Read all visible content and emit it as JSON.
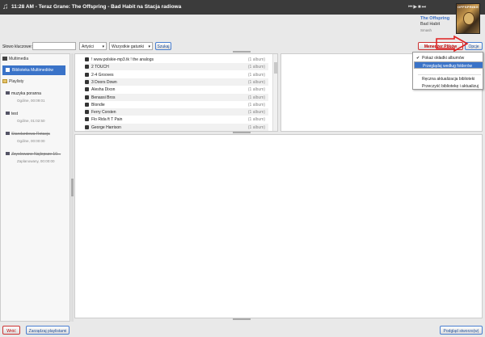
{
  "topbar": {
    "now_playing": "11:28 AM - Teraz Grane: The Offspring - Bad Habit na Stacja radiowa"
  },
  "track": {
    "artist": "The Offspring",
    "song": "Bad Habit",
    "album": "Smash",
    "cover_label": "OFFSPRING"
  },
  "search": {
    "label": "Słowo kluczowe:",
    "value": "",
    "type_select": "Artyści",
    "genre_select": "Wszystkie gatunki",
    "search_button": "Szukaj",
    "manager_button": "Menedżer Plików",
    "options_button": "Opcje"
  },
  "sidebar": {
    "multimedia": "Multimedia",
    "library": "Biblioteka Multimediów",
    "playlists_header": "Playlisty",
    "playlists": [
      {
        "name": "muzyka poranna",
        "meta": "Ogólne, 00:09:01",
        "strike": false
      },
      {
        "name": "test",
        "meta": "Ogólne, 01:02:50",
        "strike": false
      },
      {
        "name": "Standardowa Rotacja",
        "meta": "Ogólne, 00:00:00",
        "strike": true
      },
      {
        "name": "Zsyolowane Najlepsze 10...",
        "meta": "Zaplanowany, 00:00:00",
        "strike": true
      }
    ]
  },
  "artists": [
    {
      "name": "! www.polskie-mp3.tk ! the analogs",
      "count": "(1 album)"
    },
    {
      "name": "2 TOUCH",
      "count": "(1 album)"
    },
    {
      "name": "2-4 Grooves",
      "count": "(1 album)"
    },
    {
      "name": "3 Doors Down",
      "count": "(1 album)"
    },
    {
      "name": "Alesha Dixon",
      "count": "(1 album)"
    },
    {
      "name": "Benassi Bros",
      "count": "(1 album)"
    },
    {
      "name": "Blondie",
      "count": "(1 album)"
    },
    {
      "name": "Ferry Corsten",
      "count": "(1 album)"
    },
    {
      "name": "Flo Rida ft T Pain",
      "count": "(1 album)"
    },
    {
      "name": "George Harrison",
      "count": "(1 album)"
    }
  ],
  "menu": {
    "items": [
      {
        "label": "Pokaż okładki albumów",
        "checked": true,
        "selected": false
      },
      {
        "label": "Przeglądaj według folderów",
        "checked": false,
        "selected": true
      },
      {
        "label": "Ręczna aktualizacja biblioteki",
        "checked": false,
        "selected": false
      },
      {
        "label": "Przeczyść bibliotekę i aktualizuj",
        "checked": false,
        "selected": false
      }
    ]
  },
  "bottom": {
    "back": "Wróć",
    "manage_playlists": "Zarządzaj playlistami",
    "preview": "Podgląd stworzo(w)"
  },
  "colors": {
    "accent": "#3a73c8",
    "topbar": "#3b3b3b",
    "arrow": "#e02020"
  }
}
